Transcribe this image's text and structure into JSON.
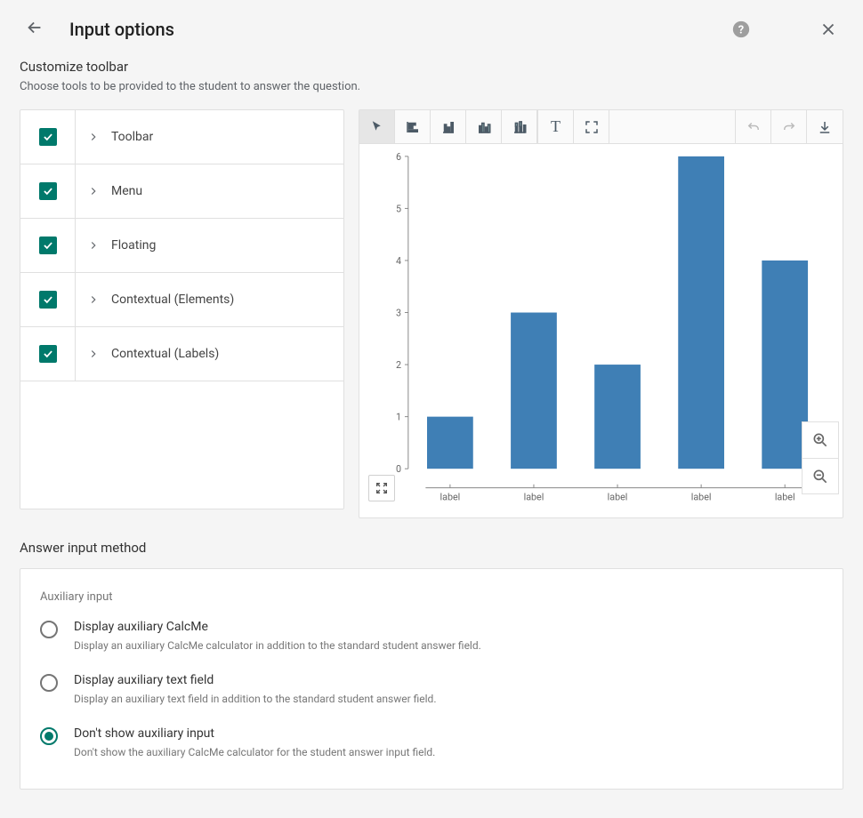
{
  "header": {
    "title": "Input options"
  },
  "customize": {
    "heading": "Customize toolbar",
    "sub": "Choose tools to be provided to the student to answer the question.",
    "items": [
      {
        "label": "Toolbar",
        "checked": true
      },
      {
        "label": "Menu",
        "checked": true
      },
      {
        "label": "Floating",
        "checked": true
      },
      {
        "label": "Contextual (Elements)",
        "checked": true
      },
      {
        "label": "Contextual (Labels)",
        "checked": true
      }
    ]
  },
  "chart_data": {
    "type": "bar",
    "categories": [
      "label",
      "label",
      "label",
      "label",
      "label"
    ],
    "values": [
      1,
      3,
      2,
      6,
      4
    ],
    "y_ticks": [
      0,
      1,
      2,
      3,
      4,
      5,
      6
    ],
    "ylim": [
      0,
      6
    ],
    "title": "",
    "xlabel": "",
    "ylabel": ""
  },
  "editor_toolbar": {
    "tools": [
      "pointer",
      "bar-chart-wide",
      "bar-chart-tall",
      "bar-chart-overlap",
      "bar-chart-stacked"
    ],
    "text_tool": "T",
    "fullscreen_tool": true,
    "undo": true,
    "redo": true,
    "download": true
  },
  "answer": {
    "heading": "Answer input method",
    "aux_heading": "Auxiliary input",
    "options": [
      {
        "label": "Display auxiliary CalcMe",
        "desc": "Display an auxiliary CalcMe calculator in addition to the standard student answer field.",
        "selected": false
      },
      {
        "label": "Display auxiliary text field",
        "desc": "Display an auxiliary text field in addition to the standard student answer field.",
        "selected": false
      },
      {
        "label": "Don't show auxiliary input",
        "desc": "Don't show the auxiliary CalcMe calculator for the student answer input field.",
        "selected": true
      }
    ]
  },
  "colors": {
    "accent": "#00796b",
    "bar": "#3f7fb5"
  }
}
